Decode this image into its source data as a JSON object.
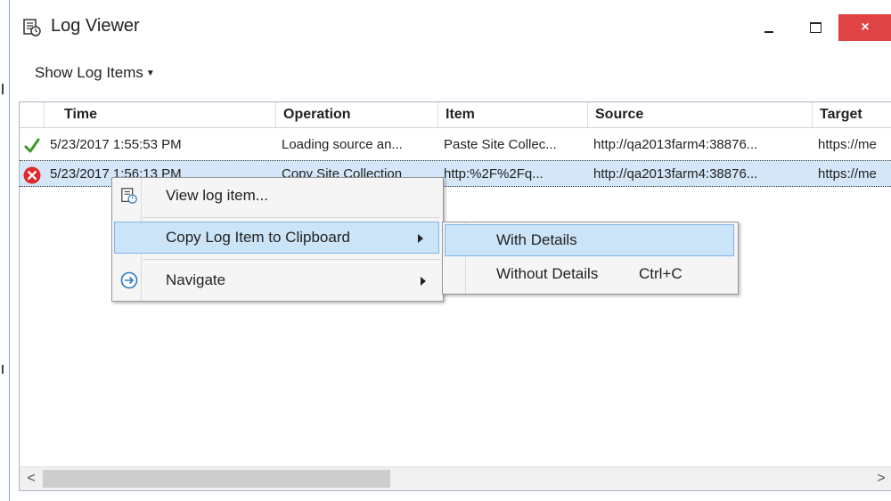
{
  "window": {
    "title": "Log Viewer",
    "title_icon": "log-viewer-icon",
    "controls": {
      "minimize": "minimize-icon",
      "maximize": "maximize-icon",
      "close": "×"
    }
  },
  "toolbar": {
    "show_log_items_label": "Show Log Items"
  },
  "grid": {
    "columns": [
      "Time",
      "Operation",
      "Item",
      "Source",
      "Target"
    ],
    "rows": [
      {
        "status": "success-check-icon",
        "time": "5/23/2017 1:55:53 PM",
        "operation": "Loading source an...",
        "item": "Paste Site Collec...",
        "source": "http://qa2013farm4:38876...",
        "target": "https://me"
      },
      {
        "status": "error-x-icon",
        "time": "5/23/2017 1:56:13 PM",
        "operation": "Copy Site Collection",
        "item": "http:%2F%2Fq...",
        "source": "http://qa2013farm4:38876...",
        "target": "https://me"
      }
    ]
  },
  "context_menu": {
    "view_log_item": "View log item...",
    "copy_log_item": "Copy Log Item to Clipboard",
    "navigate": "Navigate"
  },
  "submenu": {
    "with_details": "With Details",
    "without_details": "Without Details",
    "without_details_shortcut": "Ctrl+C"
  },
  "scrollbar": {
    "left": "<",
    "right": ">"
  },
  "colors": {
    "selection": "#d4e6f8",
    "menu_hover": "#cce4f7",
    "close_button": "#e04343",
    "success": "#3a9a2a",
    "error": "#e0282f"
  }
}
